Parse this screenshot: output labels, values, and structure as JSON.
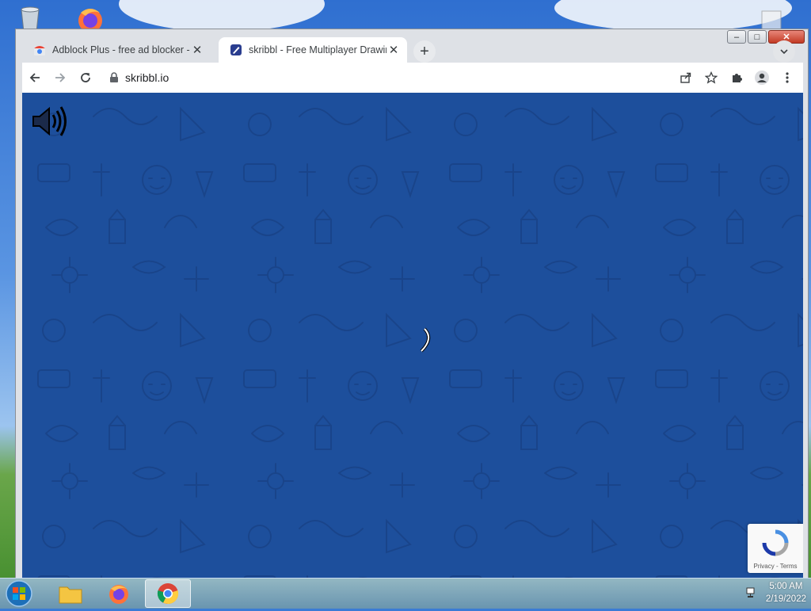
{
  "browser": {
    "tabs": [
      {
        "title": "Adblock Plus - free ad blocker - Chrome Web Store",
        "active": false
      },
      {
        "title": "skribbl - Free Multiplayer Drawing & Guessing Game",
        "active": true
      }
    ],
    "url": "skribbl.io",
    "window_controls": {
      "minimize": "–",
      "maximize": "□",
      "close": "✕"
    }
  },
  "page": {
    "background_color": "#1d4f9c",
    "recaptcha": {
      "terms": "Privacy - Terms"
    }
  },
  "taskbar": {
    "apps": [
      "file-explorer",
      "firefox",
      "chrome"
    ],
    "active_app": "chrome",
    "time": "5:00 AM",
    "date": "2/19/2022"
  },
  "icons": {
    "back": "back-arrow-icon",
    "forward": "forward-arrow-icon",
    "reload": "reload-icon",
    "lock": "lock-icon",
    "share": "share-icon",
    "bookmark": "star-icon",
    "extensions": "puzzle-icon",
    "profile": "profile-icon",
    "menu": "kebab-menu-icon"
  }
}
